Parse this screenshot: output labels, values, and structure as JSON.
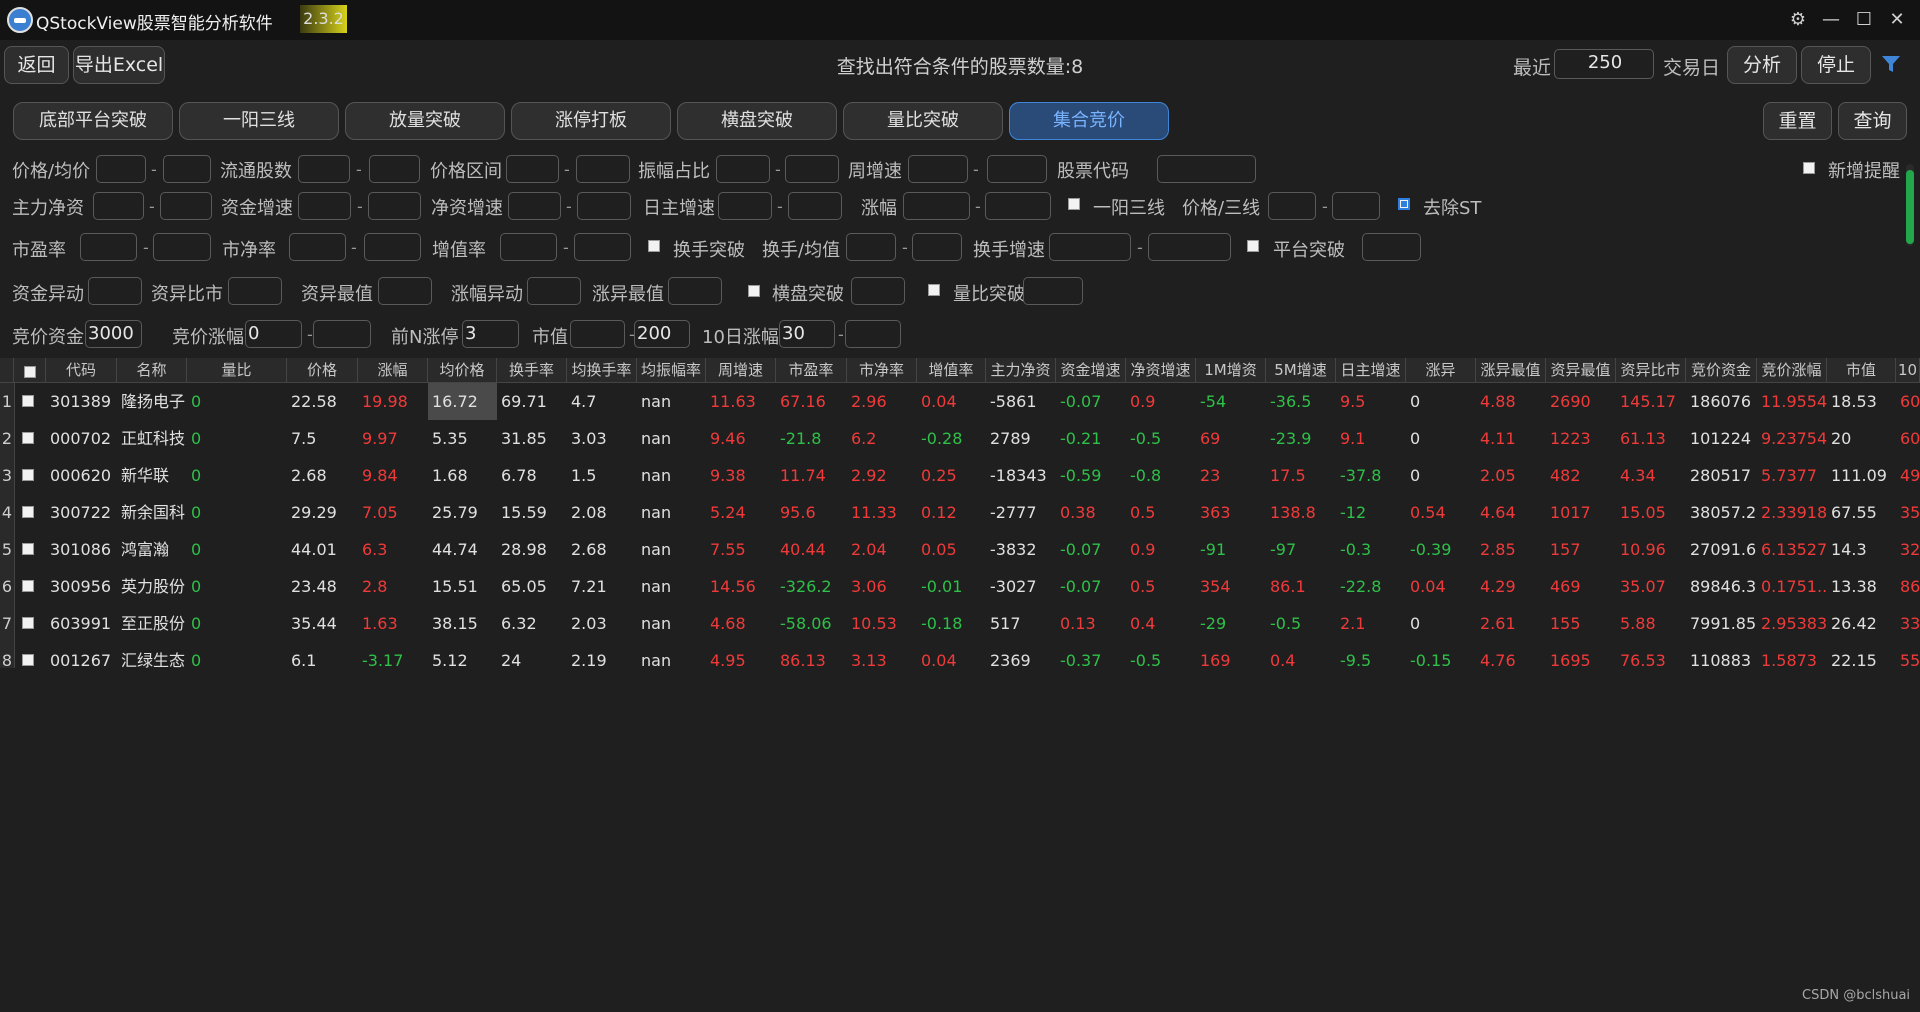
{
  "window": {
    "title": "QStockView股票智能分析软件",
    "version": "2.3.2",
    "controls": {
      "settings": "⚙",
      "minimize": "—",
      "maximize": "☐",
      "close": "✕"
    }
  },
  "toolbar": {
    "back": "返回",
    "export": "导出Excel",
    "summary": "查找出符合条件的股票数量:8",
    "recent_label": "最近",
    "recent_days": "250",
    "trading_day_label": "交易日",
    "analyze": "分析",
    "stop": "停止",
    "filter_icon": "funnel-icon"
  },
  "strategies": [
    "底部平台突破",
    "一阳三线",
    "放量突破",
    "涨停打板",
    "横盘突破",
    "量比突破",
    "集合竞价"
  ],
  "active_strategy": "集合竞价",
  "actions": {
    "reset": "重置",
    "query": "查询"
  },
  "filters": {
    "row1": {
      "price_avg": "价格/均价",
      "float_shares": "流通股数",
      "price_range": "价格区间",
      "amplitude_ratio": "振幅占比",
      "weekly_growth": "周增速",
      "stock_code": "股票代码",
      "new_alert": "新增提醒"
    },
    "row2": {
      "main_net": "主力净资",
      "fund_growth": "资金增速",
      "net_growth": "净资增速",
      "daily_main_growth": "日主增速",
      "change": "涨幅",
      "yiyang": "一阳三线",
      "price_line": "价格/三线",
      "remove_st": "去除ST"
    },
    "row3": {
      "pe": "市盈率",
      "pb": "市净率",
      "growth_rate": "增值率",
      "turnover_break": "换手突破",
      "turnover_avg": "换手/均值",
      "turnover_growth": "换手增速",
      "platform_break": "平台突破"
    },
    "row4": {
      "fund_anomaly": "资金异动",
      "anomaly_ratio": "资异比市",
      "anomaly_max": "资异最值",
      "change_anomaly": "涨幅异动",
      "change_anomaly_max": "涨异最值",
      "sideways_break": "横盘突破",
      "volume_ratio_break": "量比突破"
    },
    "row5": {
      "bid_fund": "竞价资金",
      "bid_fund_value": "3000",
      "bid_change": "竞价涨幅",
      "bid_change_min": "0",
      "top_n_limit": "前N涨停",
      "top_n_value": "3",
      "market_cap": "市值",
      "market_cap_max": "200",
      "ten_day_change": "10日涨幅",
      "ten_day_change_min": "30"
    },
    "separator": "-"
  },
  "table": {
    "headers": [
      "代码",
      "名称",
      "量比",
      "价格",
      "涨幅",
      "均价格",
      "换手率",
      "均换手率",
      "均振幅率",
      "周增速",
      "市盈率",
      "市净率",
      "增值率",
      "主力净资",
      "资金增速",
      "净资增速",
      "1M增资",
      "5M增速",
      "日主增速",
      "涨异",
      "涨异最值",
      "资异最值",
      "资异比市",
      "竞价资金",
      "竞价涨幅",
      "市值",
      "10"
    ],
    "rows": [
      {
        "num": "1",
        "cells": [
          "301389",
          "隆扬电子",
          "0",
          "22.58",
          "19.98",
          "16.72",
          "69.71",
          "4.7",
          "nan",
          "11.63",
          "67.16",
          "2.96",
          "0.04",
          "-5861",
          "-0.07",
          "0.9",
          "-54",
          "-36.5",
          "9.5",
          "0",
          "4.88",
          "2690",
          "145.17",
          "186076",
          "11.9554",
          "18.53",
          "60"
        ]
      },
      {
        "num": "2",
        "cells": [
          "000702",
          "正虹科技",
          "0",
          "7.5",
          "9.97",
          "5.35",
          "31.85",
          "3.03",
          "nan",
          "9.46",
          "-21.8",
          "6.2",
          "-0.28",
          "2789",
          "-0.21",
          "-0.5",
          "69",
          "-23.9",
          "9.1",
          "0",
          "4.11",
          "1223",
          "61.13",
          "101224",
          "9.23754",
          "20",
          "60"
        ]
      },
      {
        "num": "3",
        "cells": [
          "000620",
          "新华联",
          "0",
          "2.68",
          "9.84",
          "1.68",
          "6.78",
          "1.5",
          "nan",
          "9.38",
          "11.74",
          "2.92",
          "0.25",
          "-18343",
          "-0.59",
          "-0.8",
          "23",
          "17.5",
          "-37.8",
          "0",
          "2.05",
          "482",
          "4.34",
          "280517",
          "5.7377",
          "111.09",
          "49"
        ]
      },
      {
        "num": "4",
        "cells": [
          "300722",
          "新余国科",
          "0",
          "29.29",
          "7.05",
          "25.79",
          "15.59",
          "2.08",
          "nan",
          "5.24",
          "95.6",
          "11.33",
          "0.12",
          "-2777",
          "0.38",
          "0.5",
          "363",
          "138.8",
          "-12",
          "0.54",
          "4.64",
          "1017",
          "15.05",
          "38057.2",
          "2.33918",
          "67.55",
          "35"
        ]
      },
      {
        "num": "5",
        "cells": [
          "301086",
          "鸿富瀚",
          "0",
          "44.01",
          "6.3",
          "44.74",
          "28.98",
          "2.68",
          "nan",
          "7.55",
          "40.44",
          "2.04",
          "0.05",
          "-3832",
          "-0.07",
          "0.9",
          "-91",
          "-97",
          "-0.3",
          "-0.39",
          "2.85",
          "157",
          "10.96",
          "27091.6",
          "6.13527",
          "14.3",
          "32"
        ]
      },
      {
        "num": "6",
        "cells": [
          "300956",
          "英力股份",
          "0",
          "23.48",
          "2.8",
          "15.51",
          "65.05",
          "7.21",
          "nan",
          "14.56",
          "-326.2",
          "3.06",
          "-0.01",
          "-3027",
          "-0.07",
          "0.5",
          "354",
          "86.1",
          "-22.8",
          "0.04",
          "4.29",
          "469",
          "35.07",
          "89846.3",
          "0.1751...",
          "13.38",
          "86"
        ]
      },
      {
        "num": "7",
        "cells": [
          "603991",
          "至正股份",
          "0",
          "35.44",
          "1.63",
          "38.15",
          "6.32",
          "2.03",
          "nan",
          "4.68",
          "-58.06",
          "10.53",
          "-0.18",
          "517",
          "0.13",
          "0.4",
          "-29",
          "-0.5",
          "2.1",
          "0",
          "2.61",
          "155",
          "5.88",
          "7991.85",
          "2.95383",
          "26.42",
          "33"
        ]
      },
      {
        "num": "8",
        "cells": [
          "001267",
          "汇绿生态",
          "0",
          "6.1",
          "-3.17",
          "5.12",
          "24",
          "2.19",
          "nan",
          "4.95",
          "86.13",
          "3.13",
          "0.04",
          "2369",
          "-0.37",
          "-0.5",
          "169",
          "0.4",
          "-9.5",
          "-0.15",
          "4.76",
          "1695",
          "76.53",
          "110883",
          "1.5873",
          "22.15",
          "55"
        ]
      }
    ]
  },
  "colors": {
    "up": "#f03a3a",
    "down": "#2ec048",
    "accent": "#3f86d8",
    "bg": "#1f1f1f"
  },
  "watermark": "CSDN @bclshuai"
}
